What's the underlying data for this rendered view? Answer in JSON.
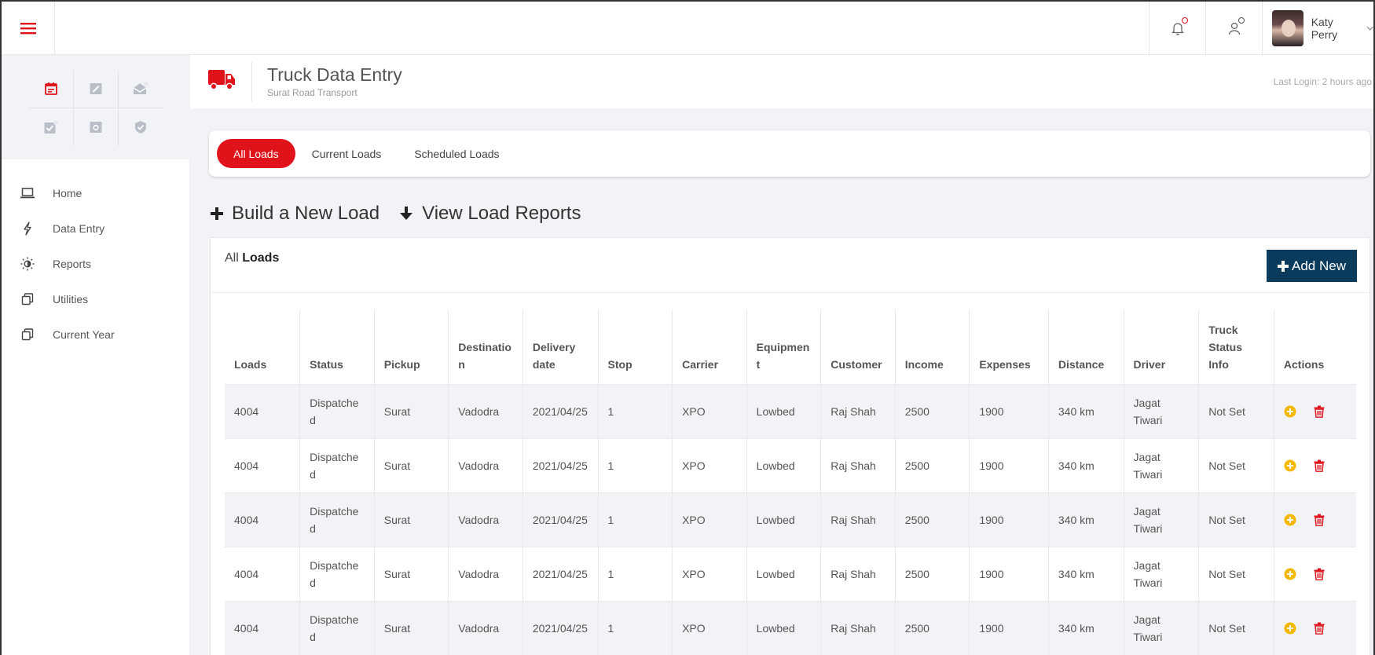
{
  "header": {
    "user_name": "Katy Perry",
    "notification_icon": "bell-icon",
    "user_icon": "user-icon"
  },
  "sidebar": {
    "quick_icons": [
      "calendar-icon",
      "edit-icon",
      "mail-icon",
      "checklist-icon",
      "camera-icon",
      "shield-icon"
    ],
    "items": [
      {
        "label": "Home",
        "icon": "laptop-icon"
      },
      {
        "label": "Data Entry",
        "icon": "bolt-icon"
      },
      {
        "label": "Reports",
        "icon": "sun-icon"
      },
      {
        "label": "Utilities",
        "icon": "copy-icon"
      },
      {
        "label": "Current Year",
        "icon": "copy-icon"
      }
    ]
  },
  "page": {
    "title": "Truck Data Entry",
    "subtitle": "Surat Road Transport",
    "last_login": "Last Login: 2 hours ago"
  },
  "tabs": [
    {
      "label": "All Loads",
      "active": true
    },
    {
      "label": "Current Loads",
      "active": false
    },
    {
      "label": "Scheduled Loads",
      "active": false
    }
  ],
  "actions": {
    "build": "Build a New Load",
    "view": "View Load Reports"
  },
  "panel": {
    "title_prefix": "All",
    "title_bold": "Loads",
    "add_label": "Add New"
  },
  "table": {
    "headers": [
      "Loads",
      "Status",
      "Pickup",
      "Destination",
      "Delivery date",
      "Stop",
      "Carrier",
      "Equipment",
      "Customer",
      "Income",
      "Expenses",
      "Distance",
      "Driver",
      "Truck Status Info",
      "Actions"
    ],
    "rows": [
      [
        "4004",
        "Dispatched",
        "Surat",
        "Vadodra",
        "2021/04/25",
        "1",
        "XPO",
        "Lowbed",
        "Raj Shah",
        "2500",
        "1900",
        "340 km",
        "Jagat Tiwari",
        "Not Set"
      ],
      [
        "4004",
        "Dispatched",
        "Surat",
        "Vadodra",
        "2021/04/25",
        "1",
        "XPO",
        "Lowbed",
        "Raj Shah",
        "2500",
        "1900",
        "340 km",
        "Jagat Tiwari",
        "Not Set"
      ],
      [
        "4004",
        "Dispatched",
        "Surat",
        "Vadodra",
        "2021/04/25",
        "1",
        "XPO",
        "Lowbed",
        "Raj Shah",
        "2500",
        "1900",
        "340 km",
        "Jagat Tiwari",
        "Not Set"
      ],
      [
        "4004",
        "Dispatched",
        "Surat",
        "Vadodra",
        "2021/04/25",
        "1",
        "XPO",
        "Lowbed",
        "Raj Shah",
        "2500",
        "1900",
        "340 km",
        "Jagat Tiwari",
        "Not Set"
      ],
      [
        "4004",
        "Dispatched",
        "Surat",
        "Vadodra",
        "2021/04/25",
        "1",
        "XPO",
        "Lowbed",
        "Raj Shah",
        "2500",
        "1900",
        "340 km",
        "Jagat Tiwari",
        "Not Set"
      ]
    ]
  },
  "colors": {
    "accent": "#e0131b",
    "button": "#0b3b5c",
    "edit_icon": "#f5b800"
  }
}
